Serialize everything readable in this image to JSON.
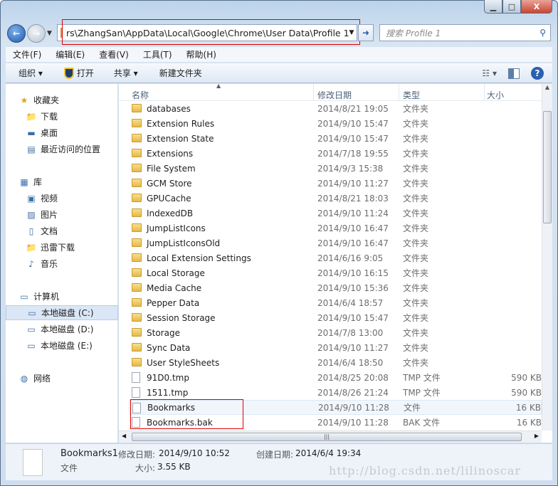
{
  "window": {
    "minimize": "▁",
    "maximize": "□",
    "close": "X"
  },
  "address": {
    "path": "rs\\ZhangSan\\AppData\\Local\\Google\\Chrome\\User Data\\Profile 1",
    "go": "➜"
  },
  "search": {
    "placeholder": "搜索 Profile 1"
  },
  "menu": [
    "文件(F)",
    "编辑(E)",
    "查看(V)",
    "工具(T)",
    "帮助(H)"
  ],
  "toolbar": {
    "organize": "组织 ▾",
    "open": "打开",
    "share": "共享 ▾",
    "new_folder": "新建文件夹"
  },
  "sidebar": [
    {
      "label": "收藏夹",
      "icon": "star-icon"
    },
    {
      "label": "下载",
      "icon": "folder-icon"
    },
    {
      "label": "桌面",
      "icon": "desktop-icon"
    },
    {
      "label": "最近访问的位置",
      "icon": "recent-icon"
    },
    {
      "label": "库",
      "icon": "library-icon"
    },
    {
      "label": "视频",
      "icon": "video-icon"
    },
    {
      "label": "图片",
      "icon": "picture-icon"
    },
    {
      "label": "文档",
      "icon": "document-icon"
    },
    {
      "label": "迅雷下载",
      "icon": "folder-icon"
    },
    {
      "label": "音乐",
      "icon": "music-icon"
    },
    {
      "label": "计算机",
      "icon": "computer-icon"
    },
    {
      "label": "本地磁盘 (C:)",
      "icon": "drive-icon"
    },
    {
      "label": "本地磁盘 (D:)",
      "icon": "drive-icon"
    },
    {
      "label": "本地磁盘 (E:)",
      "icon": "drive-icon"
    },
    {
      "label": "网络",
      "icon": "network-icon"
    }
  ],
  "columns": {
    "name": "名称",
    "date": "修改日期",
    "type": "类型",
    "size": "大小"
  },
  "files": [
    {
      "name": "databases",
      "date": "2014/8/21 19:05",
      "type": "文件夹",
      "size": "",
      "kind": "folder"
    },
    {
      "name": "Extension Rules",
      "date": "2014/9/10 15:47",
      "type": "文件夹",
      "size": "",
      "kind": "folder"
    },
    {
      "name": "Extension State",
      "date": "2014/9/10 15:47",
      "type": "文件夹",
      "size": "",
      "kind": "folder"
    },
    {
      "name": "Extensions",
      "date": "2014/7/18 19:55",
      "type": "文件夹",
      "size": "",
      "kind": "folder"
    },
    {
      "name": "File System",
      "date": "2014/9/3 15:38",
      "type": "文件夹",
      "size": "",
      "kind": "folder"
    },
    {
      "name": "GCM Store",
      "date": "2014/9/10 11:27",
      "type": "文件夹",
      "size": "",
      "kind": "folder"
    },
    {
      "name": "GPUCache",
      "date": "2014/8/21 18:03",
      "type": "文件夹",
      "size": "",
      "kind": "folder"
    },
    {
      "name": "IndexedDB",
      "date": "2014/9/10 11:24",
      "type": "文件夹",
      "size": "",
      "kind": "folder"
    },
    {
      "name": "JumpListIcons",
      "date": "2014/9/10 16:47",
      "type": "文件夹",
      "size": "",
      "kind": "folder"
    },
    {
      "name": "JumpListIconsOld",
      "date": "2014/9/10 16:47",
      "type": "文件夹",
      "size": "",
      "kind": "folder"
    },
    {
      "name": "Local Extension Settings",
      "date": "2014/6/16 9:05",
      "type": "文件夹",
      "size": "",
      "kind": "folder"
    },
    {
      "name": "Local Storage",
      "date": "2014/9/10 16:15",
      "type": "文件夹",
      "size": "",
      "kind": "folder"
    },
    {
      "name": "Media Cache",
      "date": "2014/9/10 15:36",
      "type": "文件夹",
      "size": "",
      "kind": "folder"
    },
    {
      "name": "Pepper Data",
      "date": "2014/6/4 18:57",
      "type": "文件夹",
      "size": "",
      "kind": "folder"
    },
    {
      "name": "Session Storage",
      "date": "2014/9/10 15:47",
      "type": "文件夹",
      "size": "",
      "kind": "folder"
    },
    {
      "name": "Storage",
      "date": "2014/7/8 13:00",
      "type": "文件夹",
      "size": "",
      "kind": "folder"
    },
    {
      "name": "Sync Data",
      "date": "2014/9/10 11:27",
      "type": "文件夹",
      "size": "",
      "kind": "folder"
    },
    {
      "name": "User StyleSheets",
      "date": "2014/6/4 18:50",
      "type": "文件夹",
      "size": "",
      "kind": "folder"
    },
    {
      "name": "91D0.tmp",
      "date": "2014/8/25 20:08",
      "type": "TMP 文件",
      "size": "590 KB",
      "kind": "file"
    },
    {
      "name": "1511.tmp",
      "date": "2014/8/26 21:24",
      "type": "TMP 文件",
      "size": "590 KB",
      "kind": "file"
    },
    {
      "name": "Bookmarks",
      "date": "2014/9/10 11:28",
      "type": "文件",
      "size": "16 KB",
      "kind": "file"
    },
    {
      "name": "Bookmarks.bak",
      "date": "2014/9/10 11:28",
      "type": "BAK 文件",
      "size": "16 KB",
      "kind": "file"
    }
  ],
  "status": {
    "name": "Bookmarks1",
    "modified_label": "修改日期:",
    "modified": "2014/9/10 10:52",
    "created_label": "创建日期:",
    "created": "2014/6/4 19:34",
    "type": "文件",
    "size_label": "大小:",
    "size": "3.55 KB"
  },
  "watermark": "http://blog.csdn.net/lilinoscar"
}
